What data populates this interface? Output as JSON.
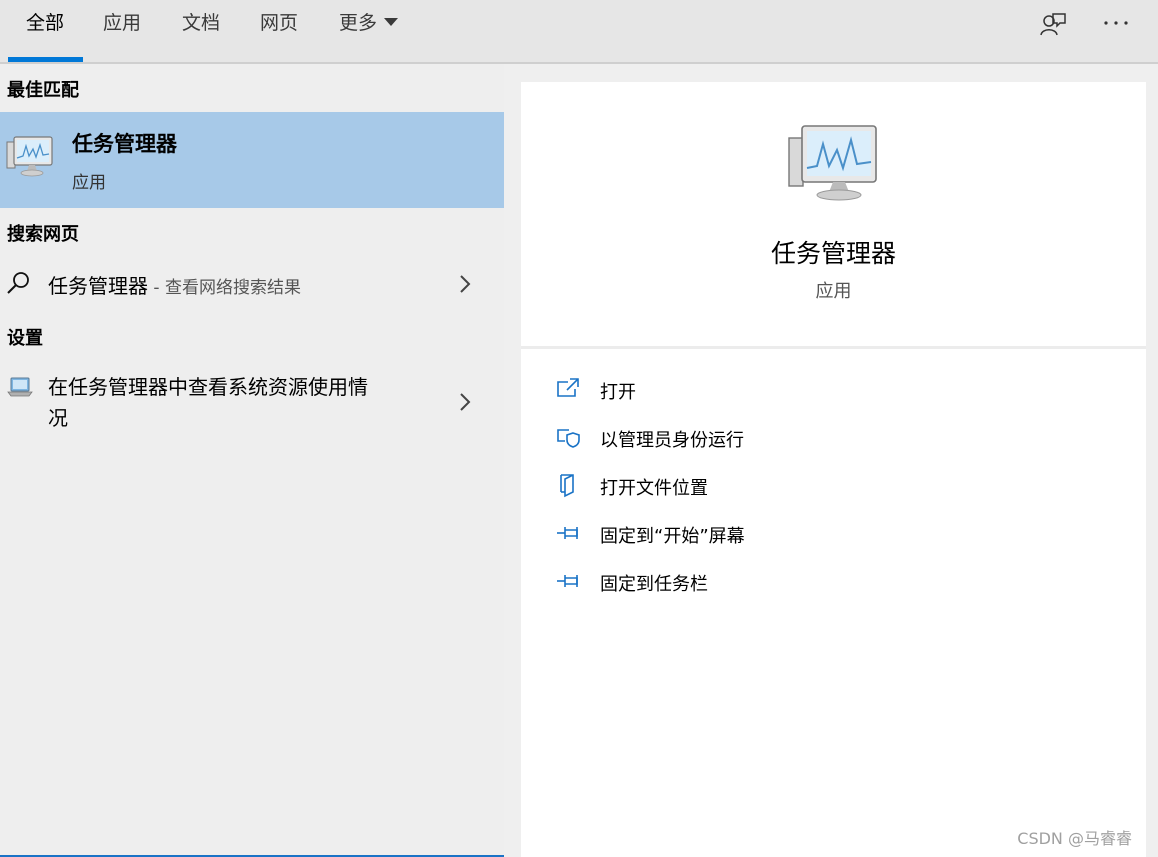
{
  "tabs": [
    {
      "label": "全部",
      "active": true
    },
    {
      "label": "应用",
      "active": false
    },
    {
      "label": "文档",
      "active": false
    },
    {
      "label": "网页",
      "active": false
    },
    {
      "label": "更多",
      "active": false
    }
  ],
  "topbar_icons": [
    "feedback-icon",
    "more-options-icon"
  ],
  "sections": {
    "best_match": "最佳匹配",
    "web": "搜索网页",
    "settings": "设置"
  },
  "best_match_item": {
    "title": "任务管理器",
    "subtitle": "应用",
    "icon": "task-manager-icon"
  },
  "web_result": {
    "query": "任务管理器",
    "hint": " - 查看网络搜索结果",
    "icon": "search-icon"
  },
  "settings_result": {
    "line1": "在任务管理器中查看系统资源使用情",
    "line2": "况",
    "icon": "laptop-settings-icon"
  },
  "preview": {
    "title": "任务管理器",
    "subtitle": "应用",
    "icon": "task-manager-icon"
  },
  "actions": [
    {
      "label": "打开",
      "icon": "open-icon"
    },
    {
      "label": "以管理员身份运行",
      "icon": "shield-icon"
    },
    {
      "label": "打开文件位置",
      "icon": "file-location-icon"
    },
    {
      "label": "固定到“开始”屏幕",
      "icon": "pin-icon"
    },
    {
      "label": "固定到任务栏",
      "icon": "pin-icon"
    }
  ],
  "colors": {
    "accent": "#0078d7",
    "selected": "#a7c9e8",
    "icon_blue": "#1a73c6"
  },
  "watermark": "CSDN @马睿睿"
}
